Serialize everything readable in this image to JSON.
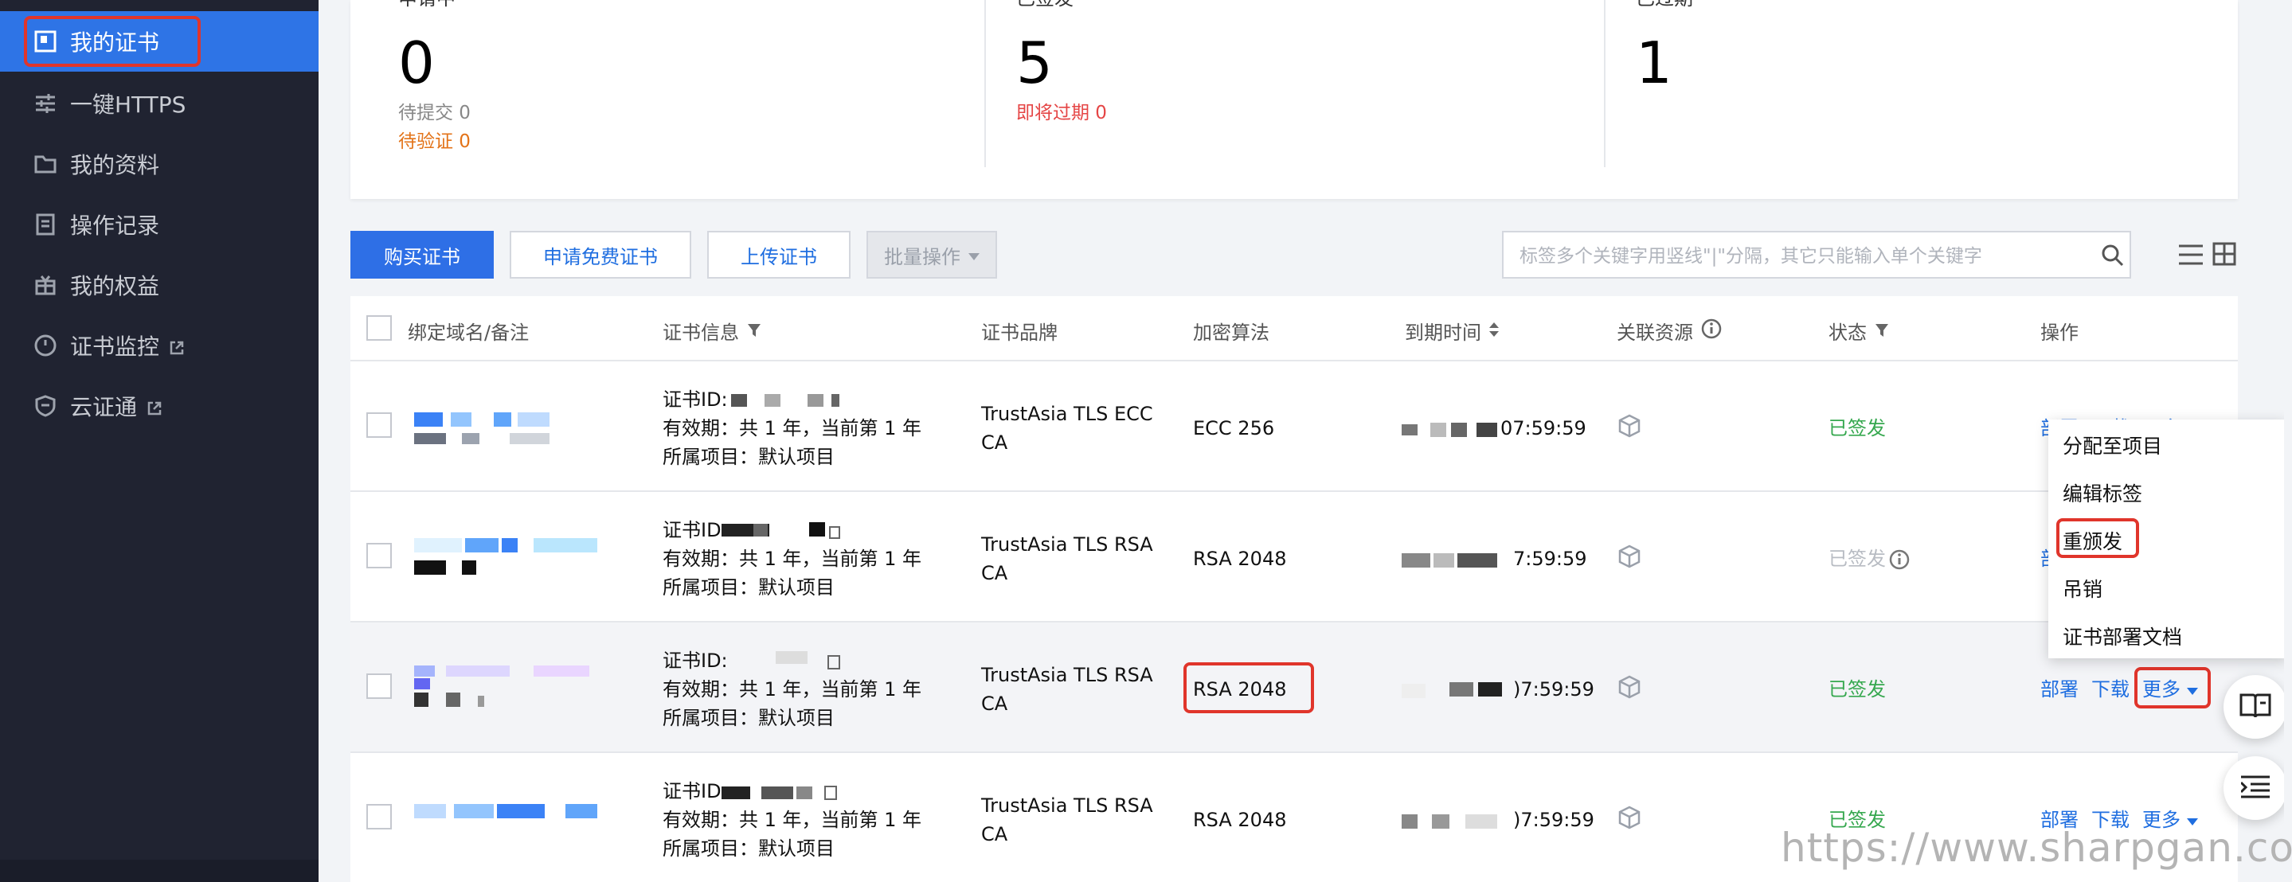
{
  "sidebar": {
    "items": [
      {
        "label": "我的证书",
        "icon": "certificate-icon"
      },
      {
        "label": "一键HTTPS",
        "icon": "sliders-icon"
      },
      {
        "label": "我的资料",
        "icon": "folder-icon"
      },
      {
        "label": "操作记录",
        "icon": "log-icon"
      },
      {
        "label": "我的权益",
        "icon": "gift-icon"
      },
      {
        "label": "证书监控",
        "icon": "monitor-icon"
      },
      {
        "label": "云证通",
        "icon": "shield-icon"
      }
    ]
  },
  "stats": {
    "applying": {
      "title": "申请中",
      "count": "0",
      "sub1": "待提交 0",
      "sub2": "待验证 0"
    },
    "issued": {
      "title": "已签发",
      "count": "5",
      "sub1": "即将过期 0"
    },
    "expired": {
      "title": "已过期",
      "count": "1"
    }
  },
  "toolbar": {
    "buy": "购买证书",
    "apply_free": "申请免费证书",
    "upload": "上传证书",
    "batch": "批量操作",
    "search_placeholder": "标签多个关键字用竖线\"|\"分隔，其它只能输入单个关键字"
  },
  "table": {
    "headers": {
      "domain": "绑定域名/备注",
      "info": "证书信息",
      "brand": "证书品牌",
      "algo": "加密算法",
      "expiry": "到期时间",
      "resource": "关联资源",
      "status": "状态",
      "actions": "操作"
    },
    "rows": [
      {
        "cert_id": "证书ID:",
        "validity": "有效期：共 1 年，当前第 1 年",
        "project": "所属项目：默认项目",
        "brand_l1": "TrustAsia TLS ECC",
        "brand_l2": "CA",
        "algo": "ECC 256",
        "expiry": "07:59:59",
        "status": "已签发",
        "deploy": "部署",
        "download": "下载",
        "more": "更多"
      },
      {
        "cert_id": "证书ID",
        "validity": "有效期：共 1 年，当前第 1 年",
        "project": "所属项目：默认项目",
        "brand_l1": "TrustAsia TLS RSA",
        "brand_l2": "CA",
        "algo": "RSA 2048",
        "expiry": "7:59:59",
        "status": "已签发",
        "deploy": "部",
        "download": "",
        "more": ""
      },
      {
        "cert_id": "证书ID:",
        "validity": "有效期：共 1 年，当前第 1 年",
        "project": "所属项目：默认项目",
        "brand_l1": "TrustAsia TLS RSA",
        "brand_l2": "CA",
        "algo": "RSA 2048",
        "expiry": ")7:59:59",
        "status": "已签发",
        "deploy": "部署",
        "download": "下载",
        "more": "更多"
      },
      {
        "cert_id": "证书ID",
        "validity": "有效期：共 1 年，当前第 1 年",
        "project": "所属项目：默认项目",
        "brand_l1": "TrustAsia TLS RSA",
        "brand_l2": "CA",
        "algo": "RSA 2048",
        "expiry": ")7:59:59",
        "status": "已签发",
        "deploy": "部署",
        "download": "下载",
        "more": "更多"
      }
    ]
  },
  "more_menu": {
    "items": [
      "分配至项目",
      "编辑标签",
      "重颁发",
      "吊销",
      "证书部署文档"
    ]
  },
  "watermark": "https://www.sharpgan.com",
  "colors": {
    "sidebar_bg": "#202331",
    "accent": "#2e6fe6",
    "success": "#36a84f",
    "highlight": "#e0352b"
  }
}
